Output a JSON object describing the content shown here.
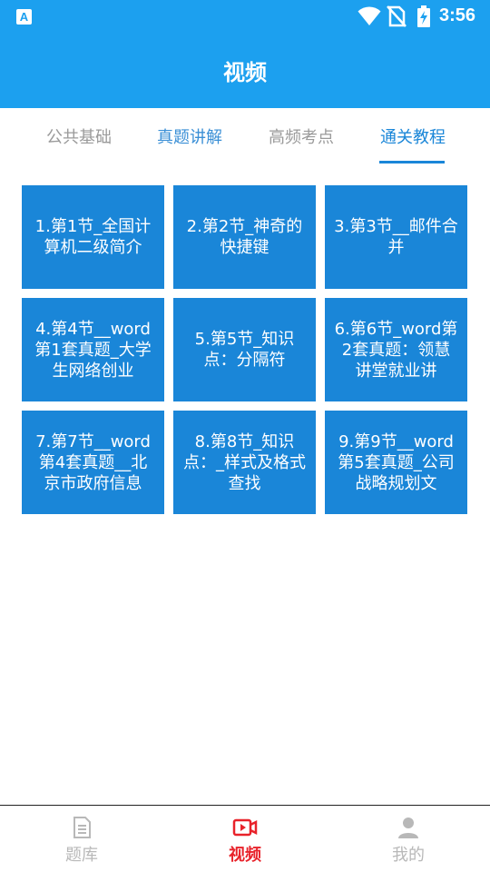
{
  "status_bar": {
    "time": "3:56",
    "app_icon_letter": "A",
    "icons": [
      "wifi-icon",
      "no-sim-icon",
      "battery-charging-icon"
    ]
  },
  "header": {
    "title": "视频"
  },
  "tabs": [
    {
      "label": "公共基础",
      "active": false
    },
    {
      "label": "真题讲解",
      "active": false
    },
    {
      "label": "高频考点",
      "active": false
    },
    {
      "label": "通关教程",
      "active": true
    }
  ],
  "videos": [
    {
      "title": "1.第1节_全国计算机二级简介"
    },
    {
      "title": "2.第2节_神奇的快捷键"
    },
    {
      "title": "3.第3节__邮件合并"
    },
    {
      "title": "4.第4节__word第1套真题_大学生网络创业"
    },
    {
      "title": "5.第5节_知识点：分隔符"
    },
    {
      "title": "6.第6节_word第2套真题：领慧讲堂就业讲"
    },
    {
      "title": "7.第7节__word第4套真题__北京市政府信息"
    },
    {
      "title": "8.第8节_知识点：_样式及格式查找"
    },
    {
      "title": "9.第9节__word第5套真题_公司战略规划文"
    }
  ],
  "bottom_nav": [
    {
      "label": "题库",
      "icon": "question-bank-icon",
      "active": false
    },
    {
      "label": "视频",
      "icon": "video-icon",
      "active": true
    },
    {
      "label": "我的",
      "icon": "profile-icon",
      "active": false
    }
  ],
  "colors": {
    "header_bg": "#1ca0ef",
    "card_bg": "#1a86d8",
    "active_tab": "#1a86d8",
    "nav_active": "#e8222a",
    "nav_inactive": "#b8b8b8"
  }
}
